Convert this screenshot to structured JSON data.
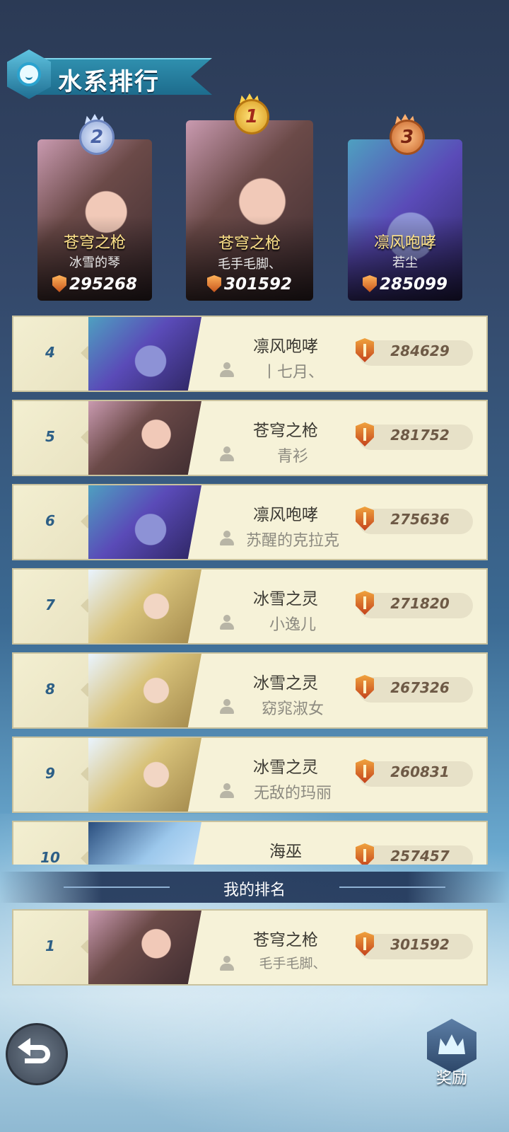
{
  "title": "水系排行",
  "podium": [
    {
      "rank": "2",
      "hero": "苍穹之枪",
      "player": "冰雪的琴",
      "score": "295268",
      "portrait": "fairy"
    },
    {
      "rank": "1",
      "hero": "苍穹之枪",
      "player": "毛手毛脚、",
      "score": "301592",
      "portrait": "fairy"
    },
    {
      "rank": "3",
      "hero": "凛风咆哮",
      "player": "若尘",
      "score": "285099",
      "portrait": "elf"
    }
  ],
  "rows": [
    {
      "rank": "4",
      "hero": "凛风咆哮",
      "player": "丨七月、",
      "score": "284629",
      "portrait": "elf"
    },
    {
      "rank": "5",
      "hero": "苍穹之枪",
      "player": "青衫",
      "score": "281752",
      "portrait": "fairy"
    },
    {
      "rank": "6",
      "hero": "凛风咆哮",
      "player": "苏醒的克拉克",
      "score": "275636",
      "portrait": "elf"
    },
    {
      "rank": "7",
      "hero": "冰雪之灵",
      "player": "小逸儿",
      "score": "271820",
      "portrait": "ice"
    },
    {
      "rank": "8",
      "hero": "冰雪之灵",
      "player": "窈窕淑女",
      "score": "267326",
      "portrait": "ice"
    },
    {
      "rank": "9",
      "hero": "冰雪之灵",
      "player": "无敌的玛丽",
      "score": "260831",
      "portrait": "ice"
    },
    {
      "rank": "10",
      "hero": "海巫",
      "player": "",
      "score": "257457",
      "portrait": "sea"
    }
  ],
  "my_rank_label": "我的排名",
  "my_rank": {
    "rank": "1",
    "hero": "苍穹之枪",
    "player": "毛手毛脚、",
    "score": "301592",
    "portrait": "fairy"
  },
  "reward_label": "奖励",
  "colors": {
    "gold_medal": "#e0a52b",
    "silver_medal": "#9fb3d9",
    "bronze_medal": "#d9823c",
    "row_bg": "#f6f2d8",
    "rank_number": "#2d5f86"
  },
  "icons": {
    "back": "back-arrow-icon",
    "reward": "crown-icon",
    "score": "shield-icon",
    "user": "user-icon"
  }
}
